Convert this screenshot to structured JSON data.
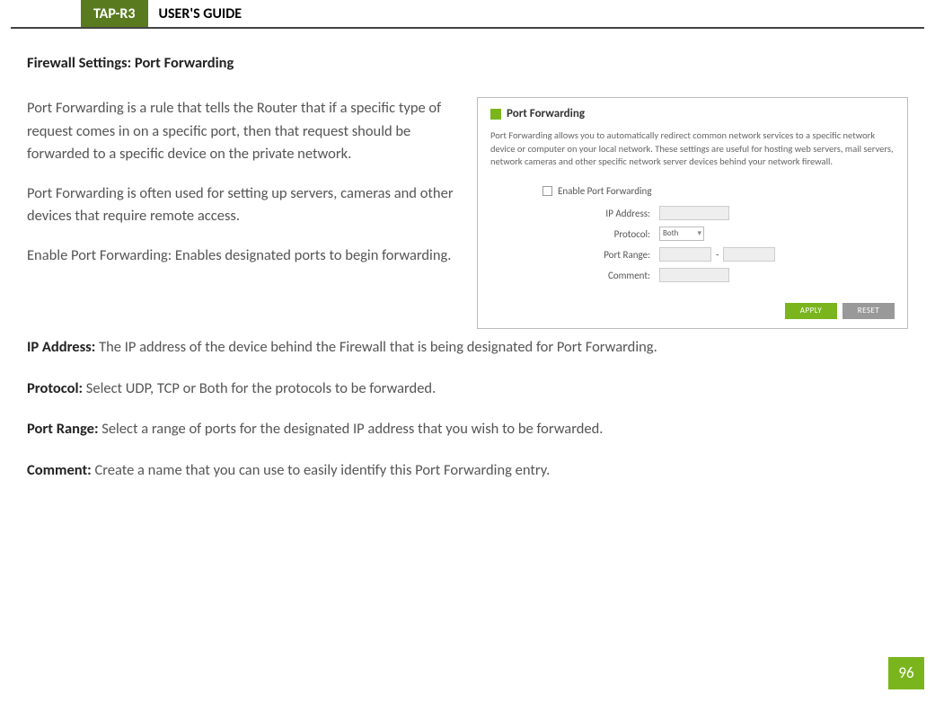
{
  "header": {
    "product": "TAP-R3",
    "title": "USER'S GUIDE"
  },
  "sectionTitle": "Firewall Settings: Port Forwarding",
  "paragraphs": {
    "p1": "Port Forwarding is a rule that tells the Router that if a specific type of request comes in on a specific port, then that request should be forwarded to a specific device on the private network.",
    "p2": "Port Forwarding is often used for setting up servers, cameras and other devices that require remote access.",
    "p3": "Enable Port Forwarding: Enables designated ports to begin forwarding."
  },
  "definitions": {
    "ip_label": "IP Address:  ",
    "ip_text": "The IP address of the device behind the Firewall that is being designated for Port Forwarding.",
    "proto_label": "Protocol: ",
    "proto_text": "Select UDP, TCP or Both for the protocols to be forwarded.",
    "range_label": "Port Range: ",
    "range_text": "Select a range of ports for the designated IP address that you wish to be forwarded.",
    "comment_label": "Comment: ",
    "comment_text": "Create a name that you can use to easily identify this Port Forwarding entry."
  },
  "panel": {
    "title": "Port Forwarding",
    "desc": "Port Forwarding allows you to automatically redirect common network services to a specific network device or computer on your local network. These settings are useful for hosting web servers, mail servers, network cameras and other specific network server devices behind your network firewall.",
    "enable": "Enable Port Forwarding",
    "ip": "IP Address:",
    "protocol": "Protocol:",
    "protocol_value": "Both",
    "portRange": "Port Range:",
    "dash": "-",
    "comment": "Comment:",
    "apply": "APPLY",
    "reset": "RESET"
  },
  "pageNumber": "96"
}
